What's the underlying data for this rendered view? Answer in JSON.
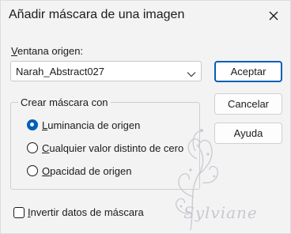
{
  "window": {
    "title": "Añadir máscara de una imagen",
    "close_icon": "close-icon"
  },
  "origin": {
    "label_underlined": "V",
    "label_rest": "entana origen:",
    "selected_value": "Narah_Abstract027",
    "dropdown_icon": "chevron-down-icon"
  },
  "mask_group": {
    "legend": "Crear máscara con",
    "options": [
      {
        "underlined": "L",
        "rest": "uminancia de origen",
        "checked": true
      },
      {
        "underlined": "C",
        "rest": "ualquier valor distinto de cero",
        "checked": false
      },
      {
        "underlined": "O",
        "rest": "pacidad de origen",
        "checked": false
      }
    ]
  },
  "buttons": {
    "accept": "Aceptar",
    "cancel": "Cancelar",
    "help": "Ayuda"
  },
  "invert": {
    "underlined": "I",
    "rest": "nvertir datos de máscara",
    "checked": false
  },
  "watermark": {
    "text": "Sylviane"
  },
  "colors": {
    "accent": "#005fb8",
    "background": "#f3f3f3"
  }
}
